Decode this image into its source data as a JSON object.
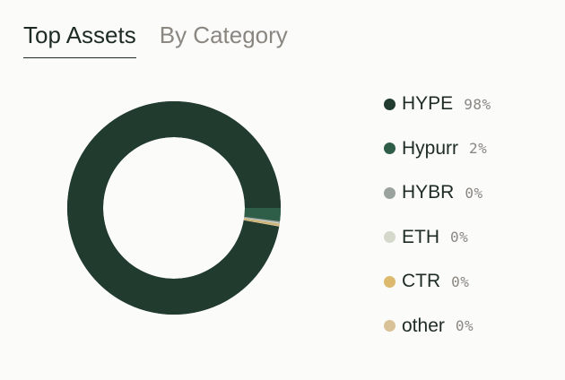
{
  "tabs": [
    {
      "label": "Top Assets",
      "active": true
    },
    {
      "label": "By Category",
      "active": false
    }
  ],
  "chart_data": {
    "type": "pie",
    "donut": true,
    "title": "",
    "categories": [
      "HYPE",
      "Hypurr",
      "HYBR",
      "ETH",
      "CTR",
      "other"
    ],
    "values": [
      98,
      2,
      0,
      0,
      0,
      0
    ],
    "colors": [
      "#213b2e",
      "#2f5e48",
      "#9aa49c",
      "#d4d9cc",
      "#dcb96c",
      "#d9c295"
    ]
  },
  "legend": {
    "items": [
      {
        "name": "HYPE",
        "pct": "98%",
        "color": "#213b2e"
      },
      {
        "name": "Hypurr",
        "pct": "2%",
        "color": "#2f5e48"
      },
      {
        "name": "HYBR",
        "pct": "0%",
        "color": "#9aa49c"
      },
      {
        "name": "ETH",
        "pct": "0%",
        "color": "#d4d9cc"
      },
      {
        "name": "CTR",
        "pct": "0%",
        "color": "#dcb96c"
      },
      {
        "name": "other",
        "pct": "0%",
        "color": "#d9c295"
      }
    ]
  }
}
